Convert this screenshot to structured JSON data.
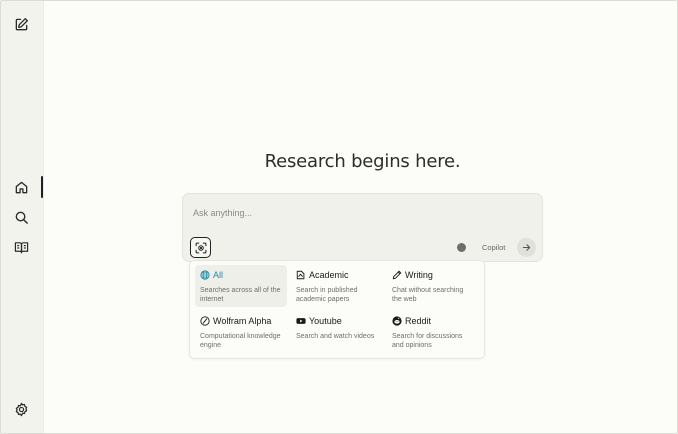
{
  "headline": "Research begins here.",
  "search": {
    "placeholder": "Ask anything..."
  },
  "copilot": {
    "label": "Copilot"
  },
  "sidebar": {
    "icons": [
      "new-thread-icon",
      "home-icon",
      "discover-icon",
      "library-icon",
      "settings-icon"
    ]
  },
  "focus_options": [
    {
      "title": "All",
      "desc": "Searches across all of the internet",
      "icon": "globe-icon",
      "selected": true
    },
    {
      "title": "Academic",
      "desc": "Search in published academic papers",
      "icon": "academic-icon",
      "selected": false
    },
    {
      "title": "Writing",
      "desc": "Chat without searching the web",
      "icon": "pencil-icon",
      "selected": false
    },
    {
      "title": "Wolfram Alpha",
      "desc": "Computational knowledge engine",
      "icon": "wolfram-icon",
      "selected": false
    },
    {
      "title": "Youtube",
      "desc": "Search and watch videos",
      "icon": "youtube-icon",
      "selected": false
    },
    {
      "title": "Reddit",
      "desc": "Search for discussions and opinions",
      "icon": "reddit-icon",
      "selected": false
    }
  ],
  "colors": {
    "accent": "#1f8aa8",
    "background": "#fcfcf9",
    "sidebar": "#f3f3ee"
  }
}
